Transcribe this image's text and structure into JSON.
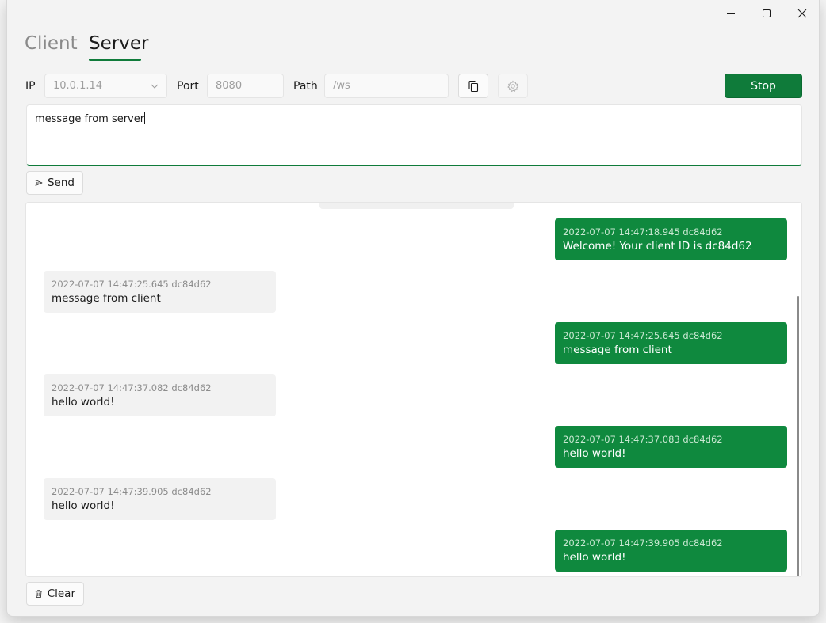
{
  "tabs": [
    {
      "label": "Client",
      "active": false
    },
    {
      "label": "Server",
      "active": true
    }
  ],
  "toolbar": {
    "ip_label": "IP",
    "ip_value": "10.0.1.14",
    "port_label": "Port",
    "port_value": "8080",
    "path_label": "Path",
    "path_value": "/ws",
    "stop_label": "Stop"
  },
  "composer": {
    "text": "message from server",
    "send_label": "Send"
  },
  "messages": [
    {
      "side": "right",
      "time": "2022-07-07 14:47:18.945 dc84d62",
      "text": "Welcome! Your client ID is dc84d62"
    },
    {
      "side": "left",
      "time": "2022-07-07 14:47:25.645 dc84d62",
      "text": "message from client"
    },
    {
      "side": "right",
      "time": "2022-07-07 14:47:25.645 dc84d62",
      "text": "message from client"
    },
    {
      "side": "left",
      "time": "2022-07-07 14:47:37.082 dc84d62",
      "text": "hello world!"
    },
    {
      "side": "right",
      "time": "2022-07-07 14:47:37.083 dc84d62",
      "text": "hello world!"
    },
    {
      "side": "left",
      "time": "2022-07-07 14:47:39.905 dc84d62",
      "text": "hello world!"
    },
    {
      "side": "right",
      "time": "2022-07-07 14:47:39.905 dc84d62",
      "text": "hello world!"
    }
  ],
  "footer": {
    "clear_label": "Clear"
  },
  "colors": {
    "accent": "#0f7b3a",
    "bubble_sent": "#0f893e",
    "bubble_received": "#f2f2f2"
  },
  "icons": [
    "minimize-icon",
    "maximize-icon",
    "close-icon",
    "chevron-down-icon",
    "copy-icon",
    "gear-icon",
    "send-icon",
    "trash-icon"
  ]
}
